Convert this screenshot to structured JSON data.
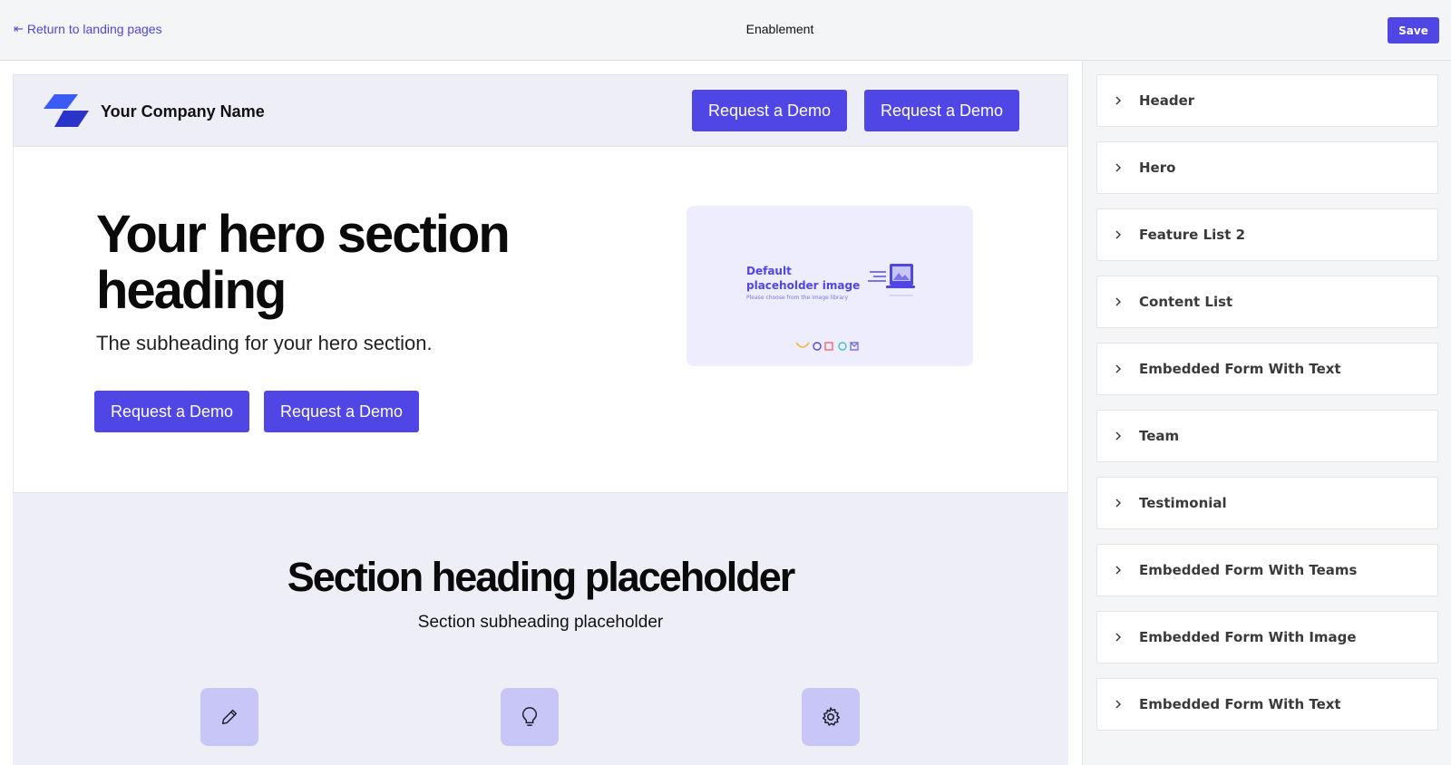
{
  "topbar": {
    "back_label": "Return to landing pages",
    "title": "Enablement",
    "save_label": "Save"
  },
  "site_header": {
    "company_name": "Your Company Name",
    "cta_1": "Request a Demo",
    "cta_2": "Request a Demo"
  },
  "hero": {
    "heading": "Your hero section heading",
    "subheading": "The subheading for your hero section.",
    "cta_1": "Request a Demo",
    "cta_2": "Request a Demo",
    "image": {
      "title_line1": "Default",
      "title_line2": "placeholder image",
      "note": "Please choose from the image library"
    }
  },
  "section": {
    "heading": "Section heading placeholder",
    "subheading": "Section subheading placeholder",
    "features": [
      {
        "icon": "pencil-icon"
      },
      {
        "icon": "lightbulb-icon"
      },
      {
        "icon": "gear-icon"
      }
    ]
  },
  "sidebar": {
    "items": [
      {
        "label": "Header"
      },
      {
        "label": "Hero"
      },
      {
        "label": "Feature List 2"
      },
      {
        "label": "Content List"
      },
      {
        "label": "Embedded Form With Text"
      },
      {
        "label": "Team"
      },
      {
        "label": "Testimonial"
      },
      {
        "label": "Embedded Form With Teams"
      },
      {
        "label": "Embedded Form With Image"
      },
      {
        "label": "Embedded Form With Text"
      }
    ]
  },
  "colors": {
    "accent": "#5046e5",
    "panel_bg": "#f4f5f7",
    "section_bg": "#eeeef6"
  }
}
